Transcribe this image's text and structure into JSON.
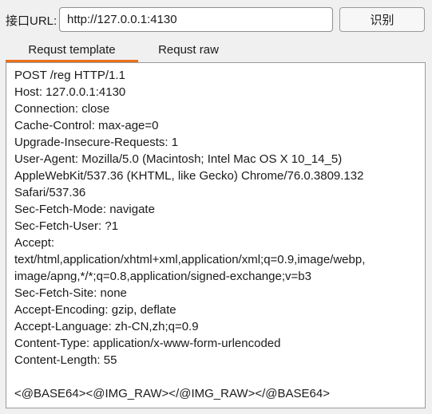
{
  "url_bar": {
    "label": "接口URL:",
    "value": "http://127.0.0.1:4130",
    "button_label": "识别"
  },
  "tabs": [
    {
      "label": "Requst template",
      "active": true
    },
    {
      "label": "Requst raw",
      "active": false
    }
  ],
  "colors": {
    "active_tab_underline": "#e8701a",
    "window_background": "#f0f0f0",
    "editor_background": "#ffffff"
  },
  "editor": {
    "lines": [
      "POST /reg HTTP/1.1",
      "Host: 127.0.0.1:4130",
      "Connection: close",
      "Cache-Control: max-age=0",
      "Upgrade-Insecure-Requests: 1",
      "User-Agent: Mozilla/5.0 (Macintosh; Intel Mac OS X 10_14_5)",
      "AppleWebKit/537.36 (KHTML, like Gecko) Chrome/76.0.3809.132",
      "Safari/537.36",
      "Sec-Fetch-Mode: navigate",
      "Sec-Fetch-User: ?1",
      "Accept:",
      "text/html,application/xhtml+xml,application/xml;q=0.9,image/webp,",
      "image/apng,*/*;q=0.8,application/signed-exchange;v=b3",
      "Sec-Fetch-Site: none",
      "Accept-Encoding: gzip, deflate",
      "Accept-Language: zh-CN,zh;q=0.9",
      "Content-Type: application/x-www-form-urlencoded",
      "Content-Length: 55",
      "",
      "<@BASE64><@IMG_RAW></@IMG_RAW></@BASE64>"
    ]
  }
}
